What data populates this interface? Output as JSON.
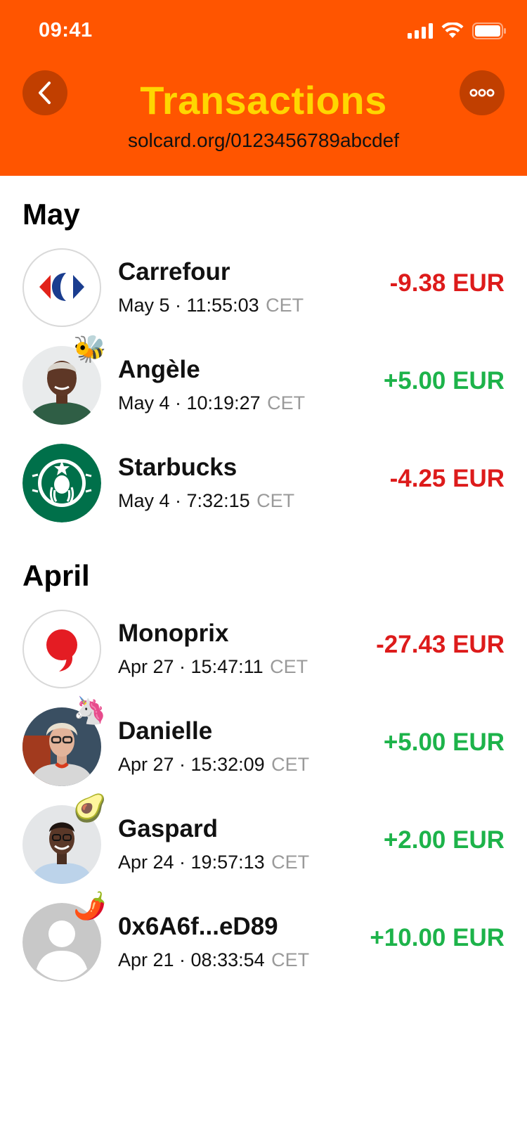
{
  "status_bar": {
    "time": "09:41"
  },
  "header": {
    "title": "Transactions",
    "subtitle": "solcard.org/0123456789abcdef"
  },
  "sections": [
    {
      "label": "May"
    },
    {
      "label": "April"
    }
  ],
  "transactions": [
    {
      "name": "Carrefour",
      "date": "May 5 · 11:55:03",
      "tz": "CET",
      "amount": "-9.38 EUR",
      "type": "debit",
      "avatar_icon": "carrefour-logo-icon",
      "badge": ""
    },
    {
      "name": "Angèle",
      "date": "May 4 · 10:19:27",
      "tz": "CET",
      "amount": "+5.00 EUR",
      "type": "credit",
      "avatar_icon": "person-photo",
      "badge": "🐝"
    },
    {
      "name": "Starbucks",
      "date": "May 4 · 7:32:15",
      "tz": "CET",
      "amount": "-4.25 EUR",
      "type": "debit",
      "avatar_icon": "starbucks-logo-icon",
      "badge": ""
    },
    {
      "name": "Monoprix",
      "date": "Apr 27 · 15:47:11",
      "tz": "CET",
      "amount": "-27.43 EUR",
      "type": "debit",
      "avatar_icon": "monoprix-logo-icon",
      "badge": ""
    },
    {
      "name": "Danielle",
      "date": "Apr 27 · 15:32:09",
      "tz": "CET",
      "amount": "+5.00 EUR",
      "type": "credit",
      "avatar_icon": "person-photo",
      "badge": "🦄"
    },
    {
      "name": "Gaspard",
      "date": "Apr 24 · 19:57:13",
      "tz": "CET",
      "amount": "+2.00 EUR",
      "type": "credit",
      "avatar_icon": "person-photo",
      "badge": "🥑"
    },
    {
      "name": "0x6A6f...eD89",
      "date": "Apr 21 · 08:33:54",
      "tz": "CET",
      "amount": "+10.00 EUR",
      "type": "credit",
      "avatar_icon": "default-user-icon",
      "badge": "🌶️"
    }
  ],
  "colors": {
    "header_bg": "#ff5500",
    "title": "#ffd600",
    "debit": "#dd1b1b",
    "credit": "#1db34a"
  }
}
